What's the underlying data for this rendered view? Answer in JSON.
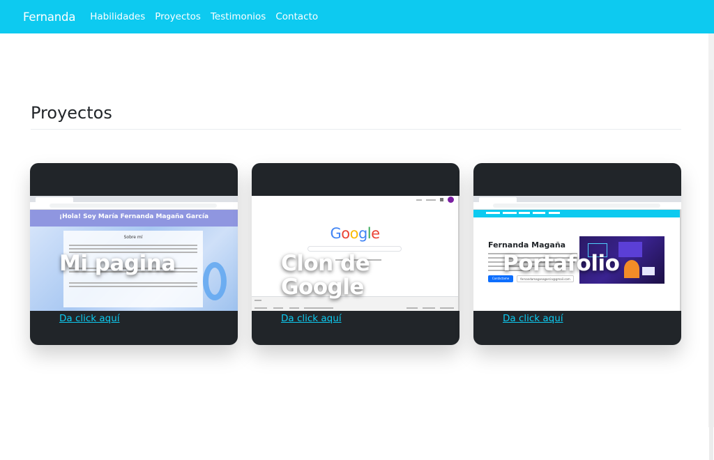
{
  "navbar": {
    "brand": "Fernanda",
    "links": [
      "Habilidades",
      "Proyectos",
      "Testimonios",
      "Contacto"
    ]
  },
  "section": {
    "title": "Proyectos"
  },
  "projects": [
    {
      "title": "Mi pagina",
      "link": "Da click aquí",
      "preview_heading": "¡Hola! Soy María Fernanda Magaña García",
      "preview_subheading": "Sobre mí"
    },
    {
      "title": "Clon de Google",
      "title_line1": "Clon de",
      "title_line2": "Google",
      "link": "Da click aquí",
      "preview_logo": "Google"
    },
    {
      "title": "Portafolio",
      "link": "Da click aquí",
      "preview_heading": "Fernanda Magaña",
      "preview_button": "Contáctame",
      "preview_email": "fernandamaganagarcia@gmail.com"
    }
  ],
  "colors": {
    "navbar": "#0dcaf0",
    "card": "#212529",
    "link": "#0dcaf0"
  }
}
